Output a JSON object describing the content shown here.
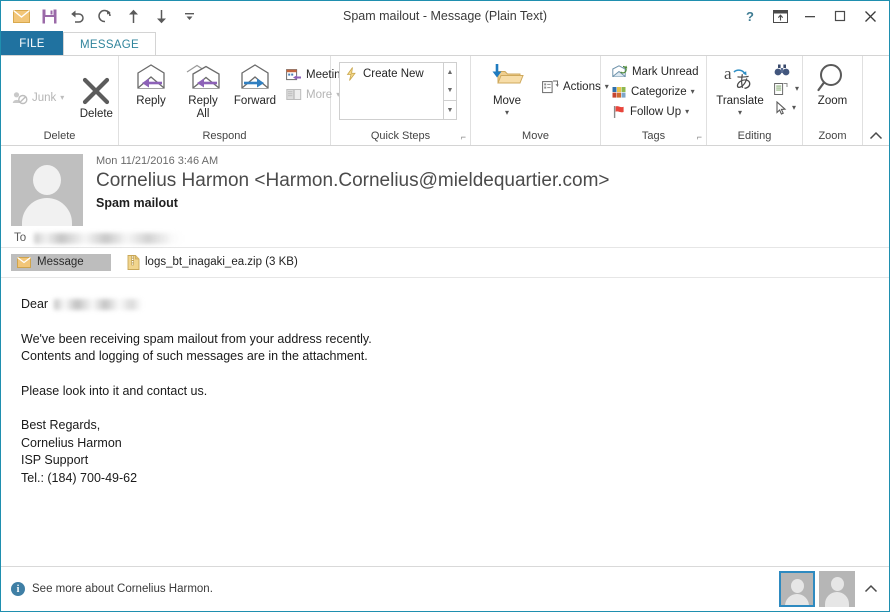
{
  "window": {
    "title": "Spam mailout - Message (Plain Text)",
    "quick_access": [
      {
        "name": "envelope-icon",
        "label": "Mail"
      },
      {
        "name": "save-icon",
        "label": "Save"
      },
      {
        "name": "undo-icon",
        "label": "Undo"
      },
      {
        "name": "redo-icon",
        "label": "Redo"
      },
      {
        "name": "previous-item-icon",
        "label": "Previous Item"
      },
      {
        "name": "next-item-icon",
        "label": "Next Item"
      },
      {
        "name": "customize-qat-icon",
        "label": "Customize Quick Access Toolbar"
      }
    ],
    "controls": {
      "help": "?",
      "ribbon_display": "Ribbon Display Options",
      "minimize": "Minimize",
      "maximize": "Maximize",
      "close": "Close"
    }
  },
  "tabs": [
    {
      "label": "FILE",
      "active": false
    },
    {
      "label": "MESSAGE",
      "active": true
    }
  ],
  "ribbon": {
    "groups": [
      {
        "label": "Delete",
        "small_buttons": [
          {
            "label": "Junk",
            "has_caret": true,
            "disabled": true
          }
        ],
        "big_buttons": [
          {
            "label": "Delete",
            "icon": "delete-x-icon"
          }
        ]
      },
      {
        "label": "Respond",
        "big_buttons": [
          {
            "label": "Reply",
            "icon": "reply-icon"
          },
          {
            "label": "Reply\nAll",
            "icon": "reply-all-icon"
          },
          {
            "label": "Forward",
            "icon": "forward-icon"
          }
        ],
        "small_buttons": [
          {
            "label": "Meeting",
            "has_caret": false,
            "disabled": false
          },
          {
            "label": "More",
            "has_caret": true,
            "disabled": true
          }
        ]
      },
      {
        "label": "Quick Steps",
        "dialog_launcher": true,
        "gallery": [
          {
            "label": "Create New",
            "icon": "lightning-icon"
          }
        ]
      },
      {
        "label": "Move",
        "big_buttons": [
          {
            "label": "Move",
            "icon": "move-folder-icon",
            "has_caret": true
          }
        ],
        "small_buttons": [
          {
            "label": "Actions",
            "has_caret": true,
            "disabled": false
          }
        ]
      },
      {
        "label": "Tags",
        "dialog_launcher": true,
        "small_buttons": [
          {
            "label": "Mark Unread",
            "has_caret": false,
            "disabled": false
          },
          {
            "label": "Categorize",
            "has_caret": true,
            "disabled": false
          },
          {
            "label": "Follow Up",
            "has_caret": true,
            "disabled": false
          }
        ]
      },
      {
        "label": "Editing",
        "big_buttons": [
          {
            "label": "Translate",
            "icon": "translate-icon",
            "has_caret": true
          }
        ],
        "small_buttons": [
          {
            "label": "",
            "icon": "find-binoculars-icon"
          },
          {
            "label": "",
            "icon": "related-document-icon",
            "has_caret": true
          },
          {
            "label": "",
            "icon": "select-pointer-icon",
            "has_caret": true
          }
        ]
      },
      {
        "label": "Zoom",
        "big_buttons": [
          {
            "label": "Zoom",
            "icon": "zoom-magnifier-icon"
          }
        ]
      }
    ],
    "collapse_label": "Collapse the Ribbon"
  },
  "message": {
    "date": "Mon 11/21/2016 3:46 AM",
    "from": "Cornelius Harmon <Harmon.Cornelius@mieldequartier.com>",
    "subject": "Spam mailout",
    "to_label": "To",
    "to_value": "",
    "attachment_tab": "Message",
    "attachment": "logs_bt_inagaki_ea.zip (3 KB)",
    "body": {
      "greeting": "Dear",
      "paragraphs": [
        "We've been receiving spam mailout from your address recently.\nContents and logging of such messages are in the attachment.",
        "Please look into it and contact us."
      ],
      "signature": "Best Regards,\nCornelius Harmon\nISP Support\nTel.: (184) 700-49-62"
    }
  },
  "status": {
    "see_more": "See more about Cornelius Harmon.",
    "people_pane_caret": "Expand People Pane"
  },
  "colors": {
    "accent": "#2072a0",
    "tab_text": "#31859c",
    "window_border": "#1f8faf",
    "reply_arrow": "#8d62b8",
    "forward_arrow": "#2f7fc1",
    "folder": "#e8c57a",
    "flag": "#e8463c"
  }
}
